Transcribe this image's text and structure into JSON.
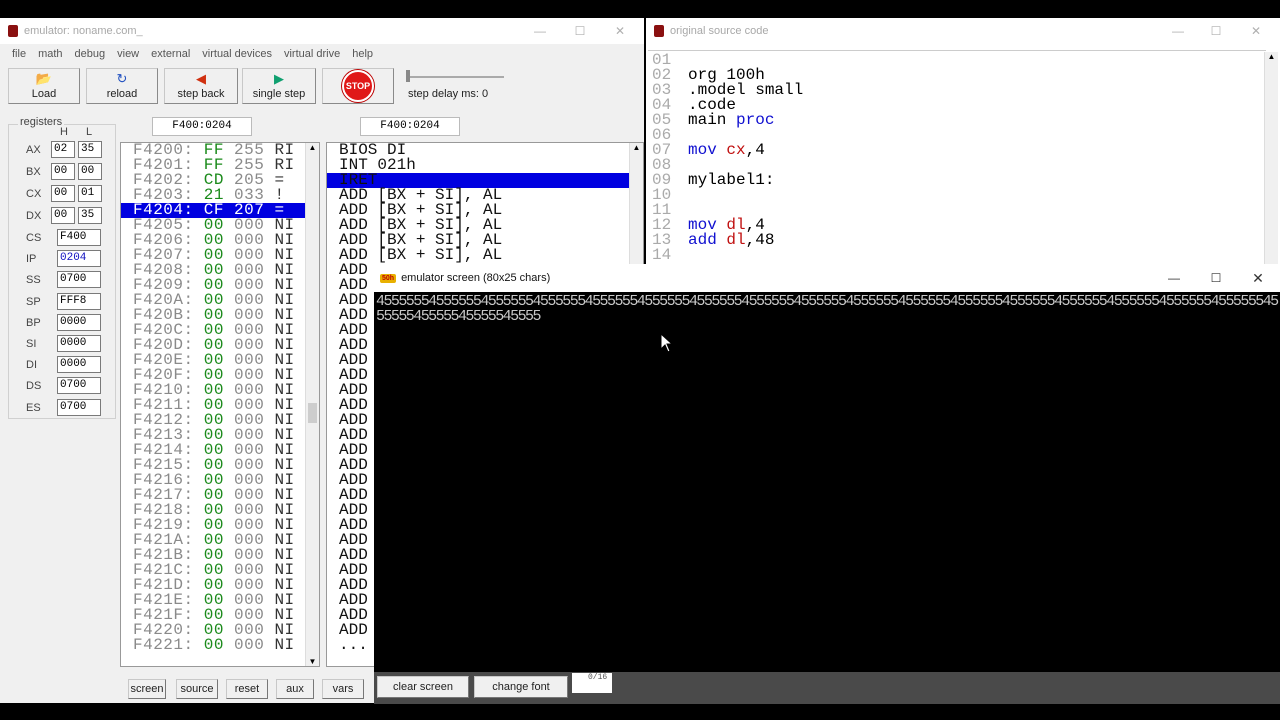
{
  "emulator": {
    "title": "emulator: noname.com_",
    "menu": [
      "file",
      "math",
      "debug",
      "view",
      "external",
      "virtual devices",
      "virtual drive",
      "help"
    ],
    "toolbar": {
      "load": "Load",
      "reload": "reload",
      "step_back": "step back",
      "single_step": "single step",
      "stop": "STOP",
      "step_delay": "step delay ms: 0"
    },
    "registers": {
      "title": "registers",
      "h": "H",
      "l": "L",
      "split": [
        {
          "name": "AX",
          "h": "02",
          "l": "35"
        },
        {
          "name": "BX",
          "h": "00",
          "l": "00"
        },
        {
          "name": "CX",
          "h": "00",
          "l": "01"
        },
        {
          "name": "DX",
          "h": "00",
          "l": "35"
        }
      ],
      "full": [
        {
          "name": "CS",
          "value": "F400"
        },
        {
          "name": "IP",
          "value": "0204"
        },
        {
          "name": "SS",
          "value": "0700"
        },
        {
          "name": "SP",
          "value": "FFF8"
        },
        {
          "name": "BP",
          "value": "0000"
        },
        {
          "name": "SI",
          "value": "0000"
        },
        {
          "name": "DI",
          "value": "0000"
        },
        {
          "name": "DS",
          "value": "0700"
        },
        {
          "name": "ES",
          "value": "0700"
        }
      ]
    },
    "memory_address": "F400:0204",
    "disasm_address": "F400:0204",
    "memory_rows": [
      {
        "addr": "F4200:",
        "hex": "FF",
        "dec": "255",
        "chr": "RI"
      },
      {
        "addr": "F4201:",
        "hex": "FF",
        "dec": "255",
        "chr": "RI"
      },
      {
        "addr": "F4202:",
        "hex": "CD",
        "dec": "205",
        "chr": "="
      },
      {
        "addr": "F4203:",
        "hex": "21",
        "dec": "033",
        "chr": "!"
      },
      {
        "addr": "F4204:",
        "hex": "CF",
        "dec": "207",
        "chr": "="
      },
      {
        "addr": "F4205:",
        "hex": "00",
        "dec": "000",
        "chr": "NI"
      },
      {
        "addr": "F4206:",
        "hex": "00",
        "dec": "000",
        "chr": "NI"
      },
      {
        "addr": "F4207:",
        "hex": "00",
        "dec": "000",
        "chr": "NI"
      },
      {
        "addr": "F4208:",
        "hex": "00",
        "dec": "000",
        "chr": "NI"
      },
      {
        "addr": "F4209:",
        "hex": "00",
        "dec": "000",
        "chr": "NI"
      },
      {
        "addr": "F420A:",
        "hex": "00",
        "dec": "000",
        "chr": "NI"
      },
      {
        "addr": "F420B:",
        "hex": "00",
        "dec": "000",
        "chr": "NI"
      },
      {
        "addr": "F420C:",
        "hex": "00",
        "dec": "000",
        "chr": "NI"
      },
      {
        "addr": "F420D:",
        "hex": "00",
        "dec": "000",
        "chr": "NI"
      },
      {
        "addr": "F420E:",
        "hex": "00",
        "dec": "000",
        "chr": "NI"
      },
      {
        "addr": "F420F:",
        "hex": "00",
        "dec": "000",
        "chr": "NI"
      },
      {
        "addr": "F4210:",
        "hex": "00",
        "dec": "000",
        "chr": "NI"
      },
      {
        "addr": "F4211:",
        "hex": "00",
        "dec": "000",
        "chr": "NI"
      },
      {
        "addr": "F4212:",
        "hex": "00",
        "dec": "000",
        "chr": "NI"
      },
      {
        "addr": "F4213:",
        "hex": "00",
        "dec": "000",
        "chr": "NI"
      },
      {
        "addr": "F4214:",
        "hex": "00",
        "dec": "000",
        "chr": "NI"
      },
      {
        "addr": "F4215:",
        "hex": "00",
        "dec": "000",
        "chr": "NI"
      },
      {
        "addr": "F4216:",
        "hex": "00",
        "dec": "000",
        "chr": "NI"
      },
      {
        "addr": "F4217:",
        "hex": "00",
        "dec": "000",
        "chr": "NI"
      },
      {
        "addr": "F4218:",
        "hex": "00",
        "dec": "000",
        "chr": "NI"
      },
      {
        "addr": "F4219:",
        "hex": "00",
        "dec": "000",
        "chr": "NI"
      },
      {
        "addr": "F421A:",
        "hex": "00",
        "dec": "000",
        "chr": "NI"
      },
      {
        "addr": "F421B:",
        "hex": "00",
        "dec": "000",
        "chr": "NI"
      },
      {
        "addr": "F421C:",
        "hex": "00",
        "dec": "000",
        "chr": "NI"
      },
      {
        "addr": "F421D:",
        "hex": "00",
        "dec": "000",
        "chr": "NI"
      },
      {
        "addr": "F421E:",
        "hex": "00",
        "dec": "000",
        "chr": "NI"
      },
      {
        "addr": "F421F:",
        "hex": "00",
        "dec": "000",
        "chr": "NI"
      },
      {
        "addr": "F4220:",
        "hex": "00",
        "dec": "000",
        "chr": "NI"
      },
      {
        "addr": "F4221:",
        "hex": "00",
        "dec": "000",
        "chr": "NI"
      }
    ],
    "selected_memory_row": 4,
    "disasm_rows": [
      "BIOS DI",
      "INT 021h",
      "IRET",
      "ADD [BX + SI], AL",
      "ADD [BX + SI], AL",
      "ADD [BX + SI], AL",
      "ADD [BX + SI], AL",
      "ADD [BX + SI], AL",
      "ADD",
      "ADD",
      "ADD",
      "ADD",
      "ADD",
      "ADD",
      "ADD",
      "ADD",
      "ADD",
      "ADD",
      "ADD",
      "ADD",
      "ADD",
      "ADD",
      "ADD",
      "ADD",
      "ADD",
      "ADD",
      "ADD",
      "ADD",
      "ADD",
      "ADD",
      "ADD",
      "ADD",
      "ADD",
      "..."
    ],
    "selected_disasm_row": 2,
    "bottom_buttons": [
      "screen",
      "source",
      "reset",
      "aux",
      "vars"
    ]
  },
  "source": {
    "title": "original source code",
    "lines": [
      {
        "num": "01",
        "parts": []
      },
      {
        "num": "02",
        "parts": [
          {
            "t": "org 100h",
            "c": ""
          }
        ]
      },
      {
        "num": "03",
        "parts": [
          {
            "t": ".model small",
            "c": ""
          }
        ]
      },
      {
        "num": "04",
        "parts": [
          {
            "t": ".code",
            "c": ""
          }
        ]
      },
      {
        "num": "05",
        "parts": [
          {
            "t": "main ",
            "c": ""
          },
          {
            "t": "proc",
            "c": "kw"
          }
        ]
      },
      {
        "num": "06",
        "parts": []
      },
      {
        "num": "07",
        "parts": [
          {
            "t": "mov ",
            "c": "kw"
          },
          {
            "t": "cx",
            "c": "rg"
          },
          {
            "t": ",4",
            "c": ""
          }
        ]
      },
      {
        "num": "08",
        "parts": []
      },
      {
        "num": "09",
        "parts": [
          {
            "t": "mylabel1:",
            "c": ""
          }
        ]
      },
      {
        "num": "10",
        "parts": []
      },
      {
        "num": "11",
        "parts": []
      },
      {
        "num": "12",
        "parts": [
          {
            "t": "mov ",
            "c": "kw"
          },
          {
            "t": "dl",
            "c": "rg"
          },
          {
            "t": ",4",
            "c": ""
          }
        ]
      },
      {
        "num": "13",
        "parts": [
          {
            "t": "add ",
            "c": "kw"
          },
          {
            "t": "dl",
            "c": "rg"
          },
          {
            "t": ",48",
            "c": ""
          }
        ]
      },
      {
        "num": "14",
        "parts": []
      }
    ]
  },
  "screen": {
    "title": "emulator screen (80x25 chars)",
    "icon_label": "50h",
    "output_line1": "4555555455555545555554555555455555545555554555555455555545555554555555455555545555554555555455555545555554555555455555545",
    "output_line2": "5555545555545555545555",
    "clear_screen": "clear screen",
    "change_font": "change font",
    "counter": "0/16"
  }
}
